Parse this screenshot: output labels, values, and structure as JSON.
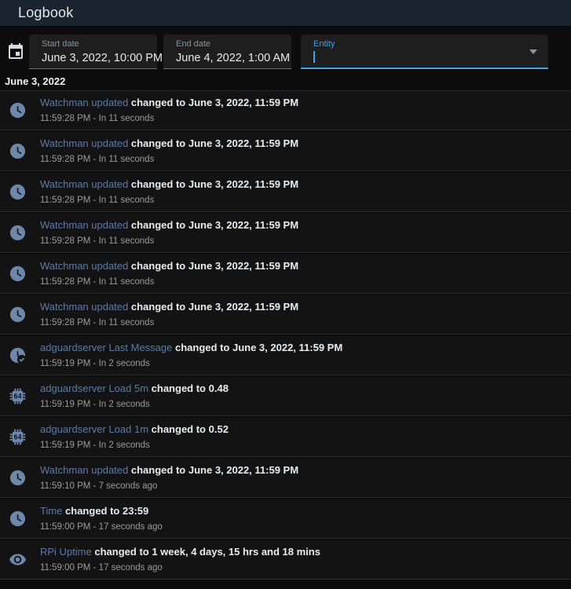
{
  "header": {
    "title": "Logbook"
  },
  "filters": {
    "start_date": {
      "label": "Start date",
      "value": "June 3, 2022, 10:00 PM"
    },
    "end_date": {
      "label": "End date",
      "value": "June 4, 2022, 1:00 AM"
    },
    "entity": {
      "label": "Entity",
      "value": ""
    }
  },
  "date_header": "June 3, 2022",
  "entries": [
    {
      "icon": "clock",
      "entity": "Watchman updated",
      "action": "changed to",
      "state": "June 3, 2022, 11:59 PM",
      "time": "11:59:28 PM",
      "relative": "In 11 seconds"
    },
    {
      "icon": "clock",
      "entity": "Watchman updated",
      "action": "changed to",
      "state": "June 3, 2022, 11:59 PM",
      "time": "11:59:28 PM",
      "relative": "In 11 seconds"
    },
    {
      "icon": "clock",
      "entity": "Watchman updated",
      "action": "changed to",
      "state": "June 3, 2022, 11:59 PM",
      "time": "11:59:28 PM",
      "relative": "In 11 seconds"
    },
    {
      "icon": "clock",
      "entity": "Watchman updated",
      "action": "changed to",
      "state": "June 3, 2022, 11:59 PM",
      "time": "11:59:28 PM",
      "relative": "In 11 seconds"
    },
    {
      "icon": "clock",
      "entity": "Watchman updated",
      "action": "changed to",
      "state": "June 3, 2022, 11:59 PM",
      "time": "11:59:28 PM",
      "relative": "In 11 seconds"
    },
    {
      "icon": "clock",
      "entity": "Watchman updated",
      "action": "changed to",
      "state": "June 3, 2022, 11:59 PM",
      "time": "11:59:28 PM",
      "relative": "In 11 seconds"
    },
    {
      "icon": "clock-check",
      "entity": "adguardserver Last Message",
      "action": "changed to",
      "state": "June 3, 2022, 11:59 PM",
      "time": "11:59:19 PM",
      "relative": "In 2 seconds"
    },
    {
      "icon": "cpu-64-bit",
      "entity": "adguardserver Load 5m",
      "action": "changed to",
      "state": "0.48",
      "time": "11:59:19 PM",
      "relative": "In 2 seconds"
    },
    {
      "icon": "cpu-64-bit",
      "entity": "adguardserver Load 1m",
      "action": "changed to",
      "state": "0.52",
      "time": "11:59:19 PM",
      "relative": "In 2 seconds"
    },
    {
      "icon": "clock",
      "entity": "Watchman updated",
      "action": "changed to",
      "state": "June 3, 2022, 11:59 PM",
      "time": "11:59:10 PM",
      "relative": "7 seconds ago"
    },
    {
      "icon": "clock",
      "entity": "Time",
      "action": "changed to",
      "state": "23:59",
      "time": "11:59:00 PM",
      "relative": "17 seconds ago"
    },
    {
      "icon": "eye",
      "entity": "RPi Uptime",
      "action": "changed to",
      "state": "1 week, 4 days, 15 hrs and 18 mins",
      "time": "11:59:00 PM",
      "relative": "17 seconds ago"
    }
  ],
  "time_separator": " - ",
  "colors": {
    "header_background": "#1a242e",
    "page_background": "#0c0c0c",
    "row_background": "#131313",
    "accent_blue": "#41a4eb",
    "entity_link_blue": "#5d7ba3",
    "icon_blue": "#6d88ac",
    "timestamp_gray": "#9b9b9b"
  }
}
